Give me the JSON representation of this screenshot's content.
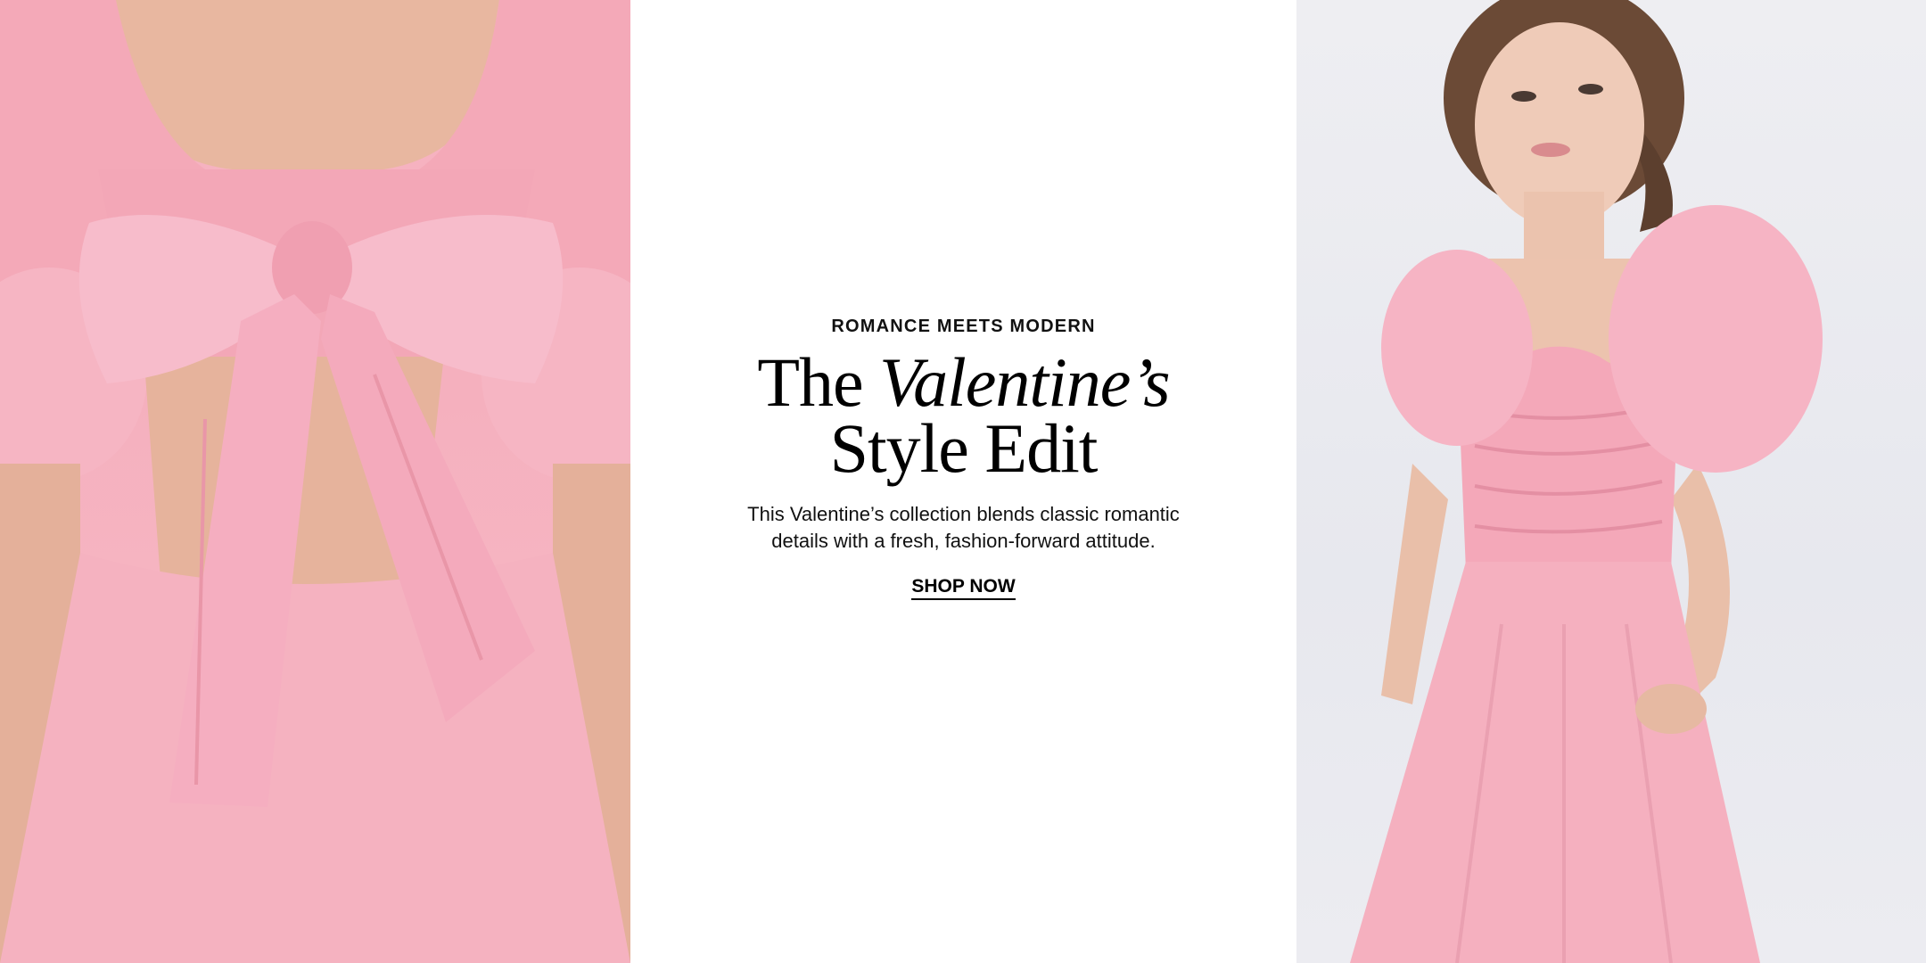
{
  "hero": {
    "eyebrow": "ROMANCE MEETS MODERN",
    "headline_regular": "The",
    "headline_italic": "Valentine’s",
    "headline_line2": "Style Edit",
    "description_line1": "This Valentine’s collection blends classic romantic",
    "description_line2": "details with a fresh, fashion-forward attitude.",
    "cta_label": "SHOP NOW"
  },
  "images": {
    "left": "pink-dress-back-bow-photo",
    "right": "pink-dress-model-front-photo"
  },
  "colors": {
    "dress_pink": "#f5b0be",
    "background_right": "#e9eaef",
    "text": "#000000"
  }
}
